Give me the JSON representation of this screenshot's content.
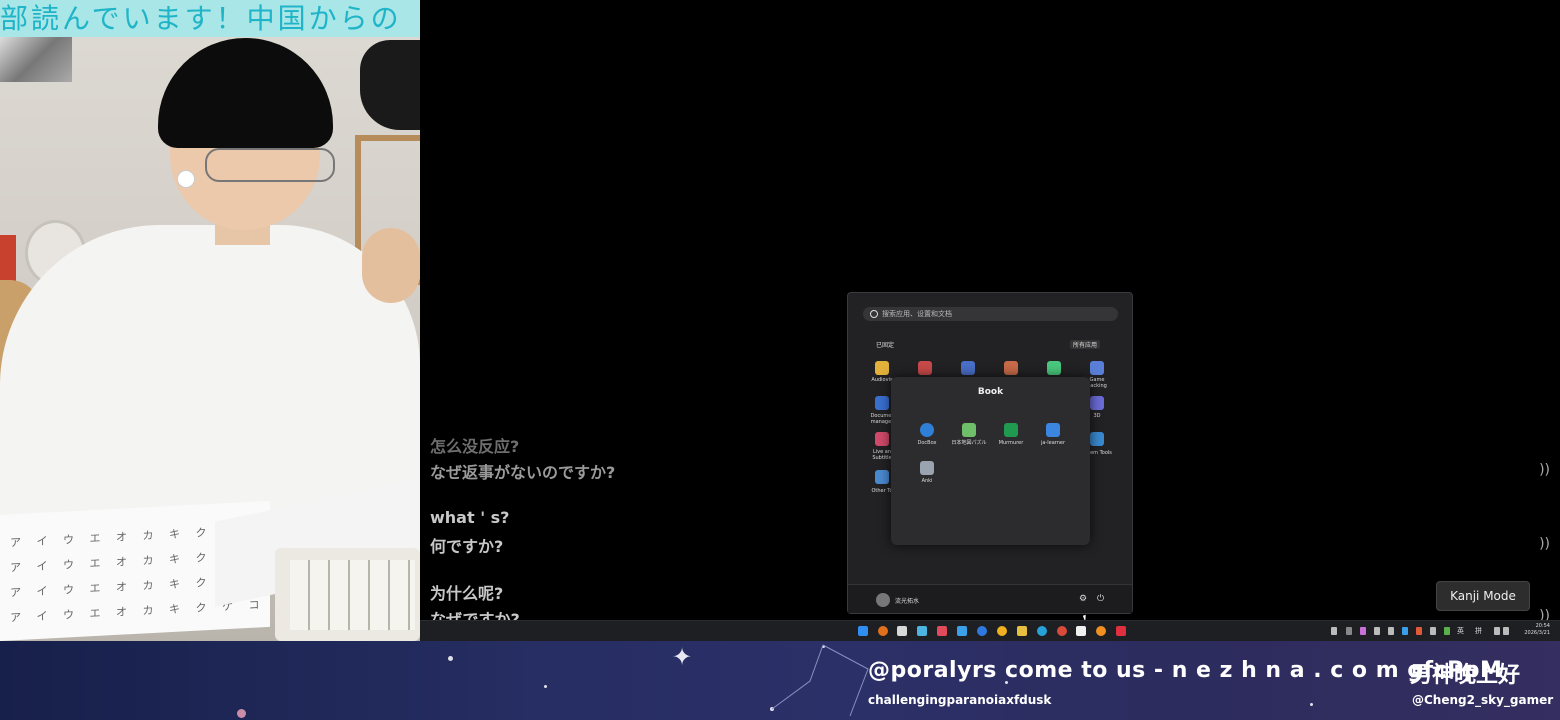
{
  "webcam": {
    "ticker_text": "部読んでいます！中国からの",
    "handwriting_row": "ア イ ウ エ オ カ キ ク ケ コ"
  },
  "subtitles": [
    {
      "line1": "怎么没反应?",
      "line2": "なぜ返事がないのですか?"
    },
    {
      "line1": "what ' s?",
      "line2": "何ですか?"
    },
    {
      "line1": "为什么呢?",
      "line2": "なぜですか?"
    }
  ],
  "side_glyph": "))",
  "start_menu": {
    "search_placeholder": "搜索应用、设置和文档",
    "pinned_label": "已固定",
    "all_apps_label": "所有应用",
    "pinned_apps": [
      {
        "label": "Audiovis"
      },
      {
        "label": "Documer manager"
      },
      {
        "label": "Live an Subtitle"
      },
      {
        "label": "Other To"
      },
      {
        "label": "Game packing"
      },
      {
        "label": "3D"
      },
      {
        "label": "em Tools"
      }
    ],
    "folder": {
      "title": "Book",
      "apps": [
        {
          "label": "DocBox",
          "icon": "docbox-icon",
          "color": "#2f7fd6"
        },
        {
          "label": "日本地図パズル",
          "icon": "map-puzzle-icon",
          "color": "#6fbf6a"
        },
        {
          "label": "Murmurer",
          "icon": "murmurer-icon",
          "color": "#1f9a4e"
        },
        {
          "label": "ja-learner",
          "icon": "ja-learner-icon",
          "color": "#3a86e0"
        },
        {
          "label": "Anki",
          "icon": "anki-icon",
          "color": "#9aa3b0"
        }
      ]
    },
    "user_name": "流光拓水"
  },
  "kanji_mode": "Kanji Mode",
  "taskbar": {
    "apps": [
      "windows-start-icon",
      "search-icon",
      "mail-icon",
      "copilot-icon",
      "brave-icon",
      "todo-icon",
      "browser-icon",
      "app-icon",
      "file-explorer-icon",
      "edge-icon",
      "chrome-icon",
      "vivaldi-icon",
      "app-icon-2",
      "app-icon-3"
    ],
    "ime_label": "英",
    "ime_label2": "拼",
    "time": "20:54",
    "date": "2026/3/21"
  },
  "banner": {
    "message": "@poralyrs come to us - n e z h n a . c o m gfcPpM",
    "user": "challengingparanoiaxfdusk",
    "greeting": "男神晚上好",
    "handle": "@Cheng2_sky_gamer"
  }
}
